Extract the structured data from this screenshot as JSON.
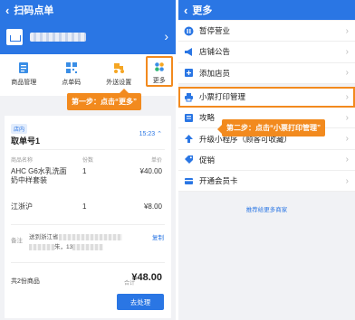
{
  "left": {
    "title": "扫码点单",
    "icons": [
      {
        "label": "商品管理",
        "icon": "product-icon"
      },
      {
        "label": "点单码",
        "icon": "qrcode-icon"
      },
      {
        "label": "外送设置",
        "icon": "delivery-icon"
      },
      {
        "label": "更多",
        "icon": "grid-icon"
      }
    ],
    "step1": "第一步：点击“更多”",
    "order": {
      "tag": "店内",
      "number": "取单号1",
      "time": "15:23",
      "col_name": "商品名称",
      "col_qty": "份数",
      "col_price": "单价",
      "items": [
        {
          "name": "AHC G6水乳洗面奶中样套装",
          "qty": "1",
          "price": "¥40.00"
        },
        {
          "name": "江浙沪",
          "qty": "1",
          "price": "¥8.00"
        }
      ],
      "remark_label": "备注",
      "remark_line1": "送到浙江省",
      "remark_line2a": "朱",
      "remark_line2b": "13",
      "copy": "复制",
      "count": "共2份商品",
      "total_label": "合计",
      "total": "¥48.00",
      "button": "去处理"
    }
  },
  "right": {
    "title": "更多",
    "items": [
      {
        "label": "暂停营业",
        "icon": "pause-icon"
      },
      {
        "label": "店铺公告",
        "icon": "megaphone-icon"
      },
      {
        "label": "添加店员",
        "icon": "add-staff-icon"
      },
      {
        "label": "小票打印管理",
        "icon": "printer-icon"
      },
      {
        "label": "攻略",
        "icon": "guide-icon"
      },
      {
        "label": "升级小程序（顾客可收藏）",
        "icon": "upgrade-icon"
      },
      {
        "label": "促销",
        "icon": "promotion-icon"
      },
      {
        "label": "开通会员卡",
        "icon": "card-icon"
      }
    ],
    "step2": "第二步：点击“小票打印管理”",
    "recommend": "推荐给更多商家"
  },
  "colors": {
    "primary": "#2a76e4",
    "accent": "#f28a1e"
  }
}
